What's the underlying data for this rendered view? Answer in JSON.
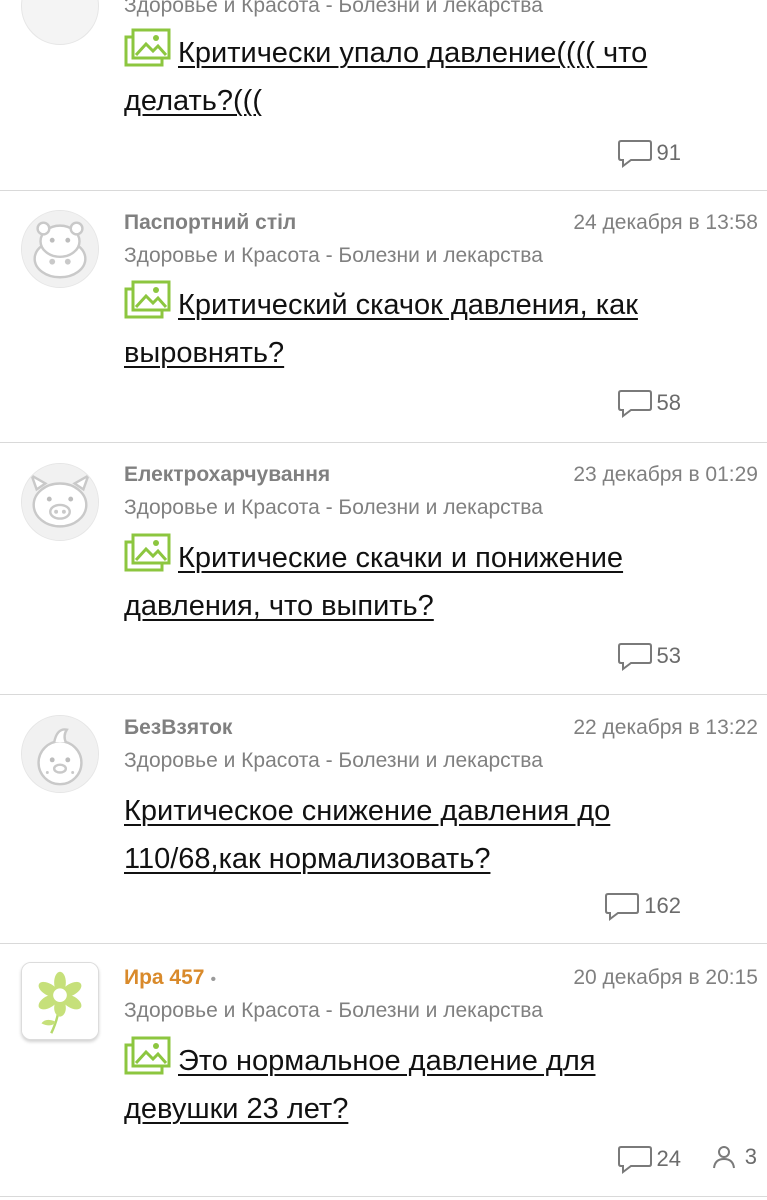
{
  "posts": [
    {
      "author": "",
      "date": "",
      "category": "Здоровье и Красота - Болезни и лекарства",
      "title": "Критически упало давление(((( что делать?(((",
      "has_image": true,
      "comments": "91"
    },
    {
      "author": "Паспортний стіл",
      "date": "24 декабря в 13:58",
      "category": "Здоровье и Красота - Болезни и лекарства",
      "title": "Критический скачок давления, как выровнять?",
      "has_image": true,
      "comments": "58",
      "avatar_icon": "hippo-avatar-icon"
    },
    {
      "author": "Електрохарчування",
      "date": "23 декабря в 01:29",
      "category": "Здоровье и Красота - Болезни и лекарства",
      "title": "Критические скачки и понижение давления, что выпить?",
      "has_image": true,
      "comments": "53",
      "avatar_icon": "pig-avatar-icon"
    },
    {
      "author": "БезВзяток",
      "date": "22 декабря в 13:22",
      "category": "Здоровье и Красота - Болезни и лекарства",
      "title": "Критическое снижение давления до 110/68,как нормализовать?",
      "has_image": false,
      "comments": "162",
      "avatar_icon": "chick-avatar-icon"
    },
    {
      "author": "Ира 457",
      "author_dot": "•",
      "date": "20 декабря в 20:15",
      "category": "Здоровье и Красота - Болезни и лекарства",
      "title": "Это нормальное давление для девушки 23 лет?",
      "has_image": true,
      "comments": "24",
      "viewers": "3",
      "avatar_icon": "flower-avatar-icon"
    }
  ],
  "colors": {
    "meta_text": "#808080",
    "author_highlight": "#d98a2b",
    "title_text": "#111111",
    "image_icon": "#8cc63f",
    "divider": "#d9d9d9"
  }
}
